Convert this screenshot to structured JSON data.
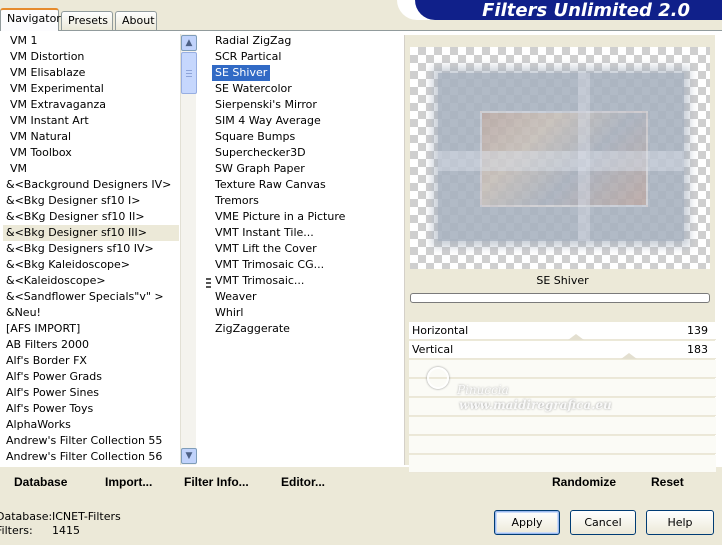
{
  "tabs": [
    {
      "label": "Navigator"
    },
    {
      "label": "Presets"
    },
    {
      "label": "About"
    }
  ],
  "banner": {
    "title": "Filters Unlimited 2.0"
  },
  "categories": [
    "VM 1",
    "VM Distortion",
    "VM Elisablaze",
    "VM Experimental",
    "VM Extravaganza",
    "VM Instant Art",
    "VM Natural",
    "VM Toolbox",
    "VM",
    "&<Background Designers IV>",
    "&<Bkg Designer sf10 I>",
    "&<BKg Designer sf10 II>",
    "&<Bkg Designer sf10 III>",
    "&<Bkg Designers sf10 IV>",
    "&<Bkg Kaleidoscope>",
    "&<Kaleidoscope>",
    "&<Sandflower Specials\"v\" >",
    "&Neu!",
    "[AFS IMPORT]",
    "AB Filters 2000",
    "Alf's Border FX",
    "Alf's Power Grads",
    "Alf's Power Sines",
    "Alf's Power Toys",
    "AlphaWorks",
    "Andrew's Filter Collection 55",
    "Andrew's Filter Collection 56"
  ],
  "current_category_index": 12,
  "filters": [
    "Radial ZigZag",
    "SCR  Partical",
    "SE Shiver",
    "SE Watercolor",
    "Sierpenski's Mirror",
    "SIM 4 Way Average",
    "Square Bumps",
    "Superchecker3D",
    "SW Graph Paper",
    "Texture Raw Canvas",
    "Tremors",
    "VME Picture in a Picture",
    "VMT Instant Tile...",
    "VMT Lift the Cover",
    "VMT Trimosaic CG...",
    "VMT Trimosaic...",
    "Weaver",
    "Whirl",
    "ZigZaggerate"
  ],
  "selected_filter_index": 2,
  "preview": {
    "filter_name": "SE Shiver"
  },
  "sliders": [
    {
      "label": "Horizontal",
      "value": "139",
      "level": 0.545
    },
    {
      "label": "Vertical",
      "value": "183",
      "level": 0.718
    }
  ],
  "watermark": {
    "line1": "Pinuccia",
    "line2": "www.maidiregrafica.eu"
  },
  "toolbar": {
    "database": "Database",
    "import": "Import...",
    "filter_info": "Filter Info...",
    "editor": "Editor...",
    "randomize": "Randomize",
    "reset": "Reset"
  },
  "status": {
    "database_label": "Database:",
    "database_value": "ICNET-Filters",
    "filters_label": "Filters:",
    "filters_value": "1415"
  },
  "dialog_buttons": {
    "apply": "Apply",
    "cancel": "Cancel",
    "help": "Help"
  },
  "colors": {
    "selection": "#316ac5",
    "banner": "#10208a",
    "tab_highlight": "#e68b2c"
  }
}
